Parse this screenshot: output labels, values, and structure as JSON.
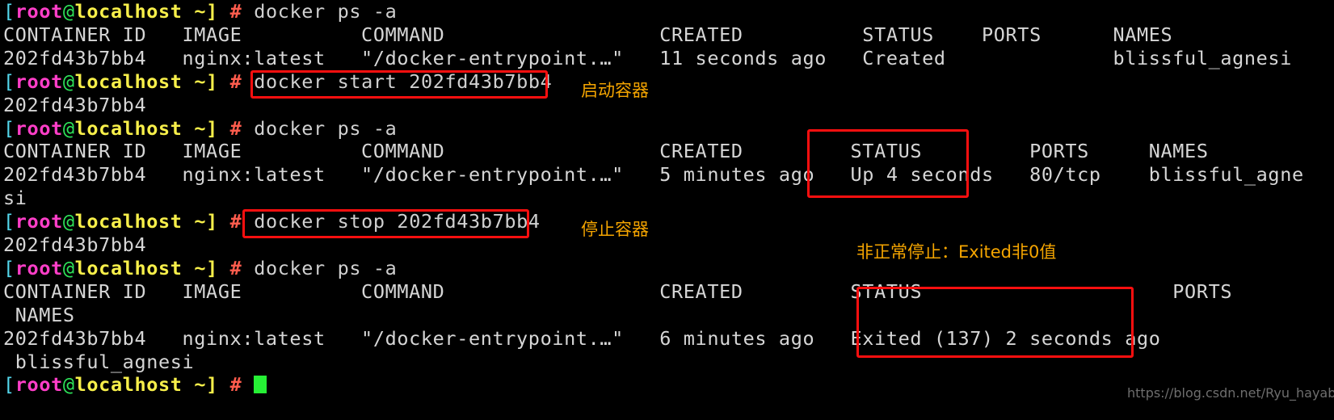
{
  "terminal": {
    "prompt": {
      "open_bracket": "[",
      "user": "root",
      "at": "@",
      "host": "localhost",
      "tilde_close": " ~]",
      "hash": "#"
    },
    "lines": [
      {
        "type": "prompt",
        "command": "docker ps -a"
      },
      {
        "type": "output",
        "text": "CONTAINER ID   IMAGE          COMMAND                  CREATED          STATUS    PORTS      NAMES"
      },
      {
        "type": "output",
        "text": "202fd43b7bb4   nginx:latest   \"/docker-entrypoint.…\"   11 seconds ago   Created              blissful_agnesi"
      },
      {
        "type": "prompt",
        "command": "docker start 202fd43b7bb4"
      },
      {
        "type": "output",
        "text": "202fd43b7bb4"
      },
      {
        "type": "prompt",
        "command": "docker ps -a"
      },
      {
        "type": "output",
        "text": "CONTAINER ID   IMAGE          COMMAND                  CREATED         STATUS         PORTS     NAMES"
      },
      {
        "type": "output",
        "text": "202fd43b7bb4   nginx:latest   \"/docker-entrypoint.…\"   5 minutes ago   Up 4 seconds   80/tcp    blissful_agne"
      },
      {
        "type": "output",
        "text": "si"
      },
      {
        "type": "prompt",
        "command": "docker stop 202fd43b7bb4"
      },
      {
        "type": "output",
        "text": "202fd43b7bb4"
      },
      {
        "type": "prompt",
        "command": "docker ps -a"
      },
      {
        "type": "output",
        "text": "CONTAINER ID   IMAGE          COMMAND                  CREATED         STATUS                     PORTS"
      },
      {
        "type": "output",
        "text": " NAMES"
      },
      {
        "type": "output",
        "text": "202fd43b7bb4   nginx:latest   \"/docker-entrypoint.…\"   6 minutes ago   Exited (137) 2 seconds ago"
      },
      {
        "type": "output",
        "text": " blissful_agnesi"
      },
      {
        "type": "prompt_cursor",
        "command": ""
      }
    ]
  },
  "annotations": {
    "start_container": "启动容器",
    "stop_container": "停止容器",
    "abnormal_exit": "非正常停止：Exited非0值"
  },
  "watermark": "https://blog.csdn.net/Ryu_hayabusa",
  "colors": {
    "background": "#000000",
    "text": "#d0d0d0",
    "highlight_box": "#fb0f0f",
    "annotation": "#f5a500",
    "prompt_user": "#ff3ec8",
    "prompt_host": "#f7ef4a",
    "prompt_hash": "#ff5c4d",
    "prompt_at": "#2ee35a",
    "prompt_bracket": "#55d9ee",
    "cursor": "#26f035",
    "watermark": "#6e6e6e"
  }
}
